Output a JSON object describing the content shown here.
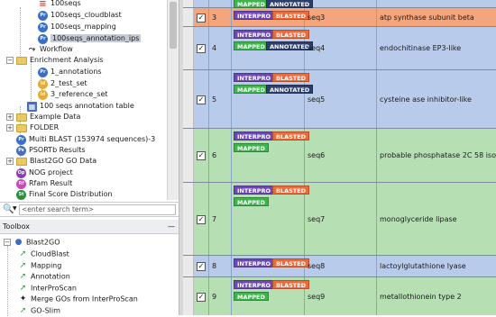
{
  "tree": {
    "items": [
      {
        "label": "100seqs",
        "icon": "list-icon"
      },
      {
        "label": "100seqs_cloudblast",
        "icon": "p-icon",
        "badge": "Pr"
      },
      {
        "label": "100seqs_mapping",
        "icon": "p-icon",
        "badge": "Pr"
      },
      {
        "label": "100seqs_annotation_ips",
        "icon": "p-icon",
        "badge": "Pr"
      },
      {
        "label": "Workflow",
        "icon": "workflow-icon"
      },
      {
        "label": "Enrichment Analysis",
        "icon": "folder-icon",
        "expander": "−"
      },
      {
        "label": "1_annotations",
        "icon": "p-icon",
        "badge": "Pr"
      },
      {
        "label": "2_test_set",
        "icon": "d-icon",
        "badge": "Id"
      },
      {
        "label": "3_reference_set",
        "icon": "d-icon",
        "badge": "Id"
      },
      {
        "label": "100 seqs annotation table",
        "icon": "table-icon"
      },
      {
        "label": "Example Data",
        "icon": "folder-icon",
        "expander": "+"
      },
      {
        "label": "FOLDER",
        "icon": "folder-icon",
        "expander": "+"
      },
      {
        "label": "Multi BLAST (153974 sequences)-3",
        "icon": "p-icon",
        "badge": "Pr"
      },
      {
        "label": "PSORTb Results",
        "icon": "p-icon",
        "badge": "Ps"
      },
      {
        "label": "Blast2GO GO Data",
        "icon": "folder-icon",
        "expander": "+"
      },
      {
        "label": "NOG project",
        "icon": "p-icon",
        "badge": "Op"
      },
      {
        "label": "Rfam Result",
        "icon": "r-icon",
        "badge": "Rf"
      },
      {
        "label": "Final Score Distribution",
        "icon": "s-icon",
        "badge": "St"
      },
      {
        "label": "cli_test_2",
        "icon": "p-icon",
        "badge": "Pr"
      }
    ]
  },
  "search": {
    "placeholder": "<enter search term>"
  },
  "toolbox": {
    "title": "Toolbox",
    "minimize": "—",
    "group": "Blast2GO",
    "items": [
      {
        "label": "CloudBlast",
        "icon": "arrow-icon"
      },
      {
        "label": "Mapping",
        "icon": "arrow-icon"
      },
      {
        "label": "Annotation",
        "icon": "arrow-icon"
      },
      {
        "label": "InterProScan",
        "icon": "arrow-icon"
      },
      {
        "label": "Merge GOs from InterProScan",
        "icon": "merge-icon"
      },
      {
        "label": "GO-Slim",
        "icon": "arrow-icon"
      }
    ]
  },
  "colors": {
    "row_orange": "#f4a57c",
    "row_blue": "#b9cbeb",
    "row_green": "#b7dfb4",
    "interpro": "#6c48b4",
    "blasted": "#ef6a38",
    "mapped": "#3eb54c",
    "annotated": "#2c3e6c"
  },
  "table": {
    "rows": [
      {
        "num": "",
        "seq": "",
        "desc": "",
        "tags": [
          "MAPPED",
          "ANNOTATED"
        ],
        "color": "blue"
      },
      {
        "num": "3",
        "seq": "seq3",
        "desc": "atp synthase subunit beta",
        "tags": [
          "INTERPRO",
          "BLASTED"
        ],
        "color": "orange"
      },
      {
        "num": "4",
        "seq": "seq4",
        "desc": "endochitinase EP3-like",
        "tags": [
          "INTERPRO",
          "BLASTED",
          "MAPPED",
          "ANNOTATED"
        ],
        "color": "blue"
      },
      {
        "num": "5",
        "seq": "seq5",
        "desc": "cysteine ase inhibitor-like",
        "tags": [
          "INTERPRO",
          "BLASTED",
          "MAPPED",
          "ANNOTATED"
        ],
        "color": "blue"
      },
      {
        "num": "6",
        "seq": "seq6",
        "desc": "probable phosphatase 2C 58 isof…",
        "tags": [
          "INTERPRO",
          "BLASTED",
          "MAPPED"
        ],
        "color": "green"
      },
      {
        "num": "7",
        "seq": "seq7",
        "desc": "monoglyceride lipase",
        "tags": [
          "INTERPRO",
          "BLASTED",
          "MAPPED"
        ],
        "color": "green"
      },
      {
        "num": "8",
        "seq": "seq8",
        "desc": "lactoylglutathione lyase",
        "tags": [
          "INTERPRO",
          "BLASTED"
        ],
        "color": "blue"
      },
      {
        "num": "9",
        "seq": "seq9",
        "desc": "metallothionein type 2",
        "tags": [
          "INTERPRO",
          "BLASTED",
          "MAPPED"
        ],
        "color": "green"
      },
      {
        "num": "",
        "seq": "",
        "desc": "",
        "tags": [],
        "color": "blue"
      }
    ]
  }
}
